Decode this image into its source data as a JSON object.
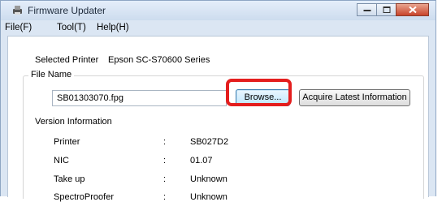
{
  "window": {
    "title": "Firmware Updater"
  },
  "menu": [
    {
      "label": "File(F)"
    },
    {
      "label": "Tool(T)"
    },
    {
      "label": "Help(H)"
    }
  ],
  "selected_printer": {
    "label": "Selected Printer",
    "value": "Epson SC-S70600 Series"
  },
  "file_name": {
    "group_label": "File Name",
    "value": "SB01303070.fpg",
    "browse_label": "Browse...",
    "acquire_label": "Acquire Latest Information"
  },
  "version_info": {
    "heading": "Version Information",
    "rows": [
      {
        "label": "Printer",
        "colon": ":",
        "value": "SB027D2"
      },
      {
        "label": "NIC",
        "colon": ":",
        "value": "01.07"
      },
      {
        "label": "Take up",
        "colon": ":",
        "value": "Unknown"
      },
      {
        "label": "SpectroProofer",
        "colon": ":",
        "value": "Unknown"
      }
    ]
  },
  "colors": {
    "highlight": "#e41e1e",
    "close_button": "#c8432b"
  }
}
